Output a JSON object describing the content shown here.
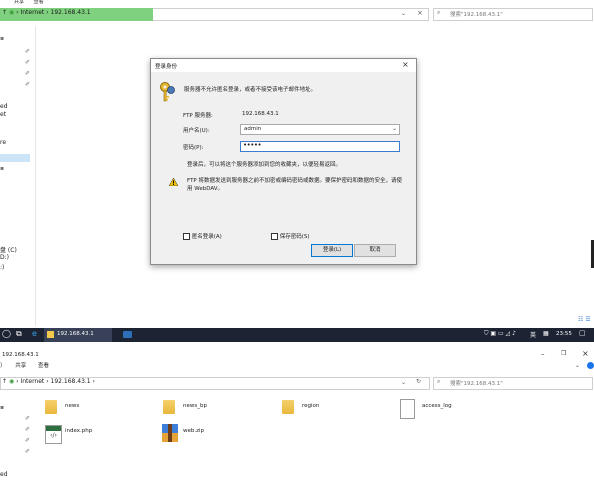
{
  "top_window": {
    "menu": [
      "共享",
      "查看"
    ],
    "address": {
      "segments": [
        "Internet",
        "192.168.43.1"
      ],
      "separator": "›"
    },
    "search_placeholder": "搜索\"192.168.43.1\"",
    "sidebar_fragments": [
      "ed",
      "et",
      "re",
      "盘 (C)",
      "D:)",
      ":)"
    ]
  },
  "dialog": {
    "title": "登录身份",
    "message": "服务器不允许匿名登录，或者不接受该电子邮件地址。",
    "ftp_server_label": "FTP 服务器:",
    "ftp_server_value": "192.168.43.1",
    "username_label": "用户名(U):",
    "username_value": "admin",
    "password_label": "密码(P):",
    "password_value": "•••••",
    "hint": "登录后，可以将这个服务器添加到您的收藏夹，以便轻易返回。",
    "warning": "FTP 将数据发送到服务器之前不加密或编码密码或数据。要保护密码和数据的安全，请使用 WebDAV。",
    "anonymous_label": "匿名登录(A)",
    "save_password_label": "保存密码(S)",
    "login_button": "登录(L)",
    "cancel_button": "取消"
  },
  "taskbar": {
    "task_label": "192.168.43.1",
    "lang": "英",
    "time": "23:55"
  },
  "bottom_window": {
    "title": "192.168.43.1",
    "menu": [
      "共享",
      "查看"
    ],
    "address": {
      "segments": [
        "Internet",
        "192.168.43.1"
      ]
    },
    "search_placeholder": "搜索\"192.168.43.1\"",
    "items": [
      {
        "name": "news",
        "type": "folder"
      },
      {
        "name": "news_bp",
        "type": "folder"
      },
      {
        "name": "region",
        "type": "folder"
      },
      {
        "name": "access_log",
        "type": "file"
      },
      {
        "name": "index.php",
        "type": "php"
      },
      {
        "name": "web.zip",
        "type": "zip"
      }
    ],
    "sidebar_fragments": [
      "ed"
    ]
  }
}
